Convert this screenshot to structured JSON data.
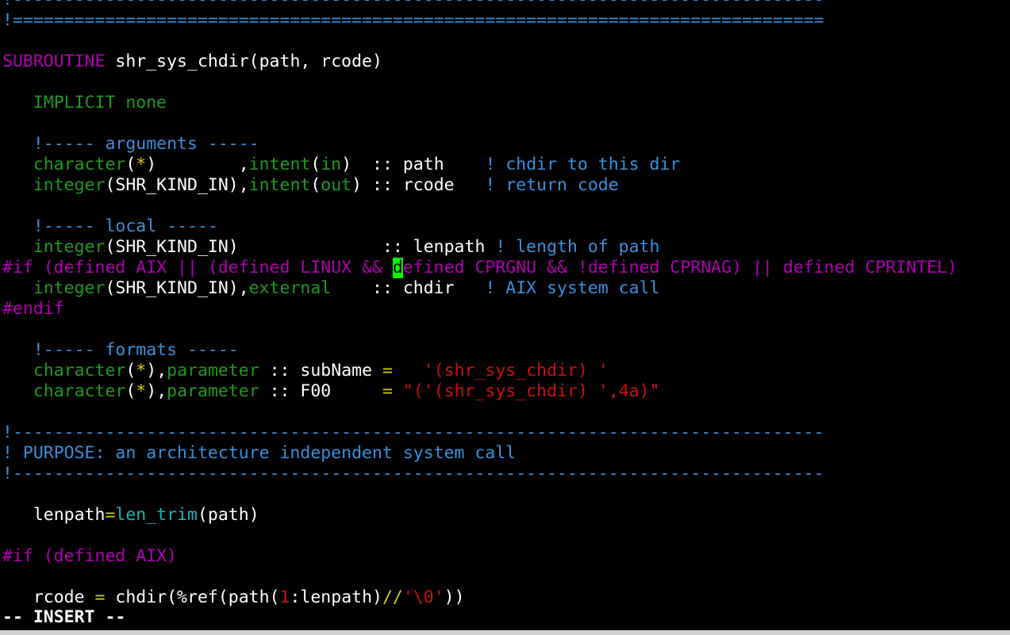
{
  "colors": {
    "background": "#000000",
    "text": "#ffffff",
    "comment": "#3a8fd8",
    "keyword": "#b000b0",
    "type": "#1f9a1f",
    "string": "#cc1010",
    "operator": "#d2d200",
    "func": "#22b0b0",
    "cursor_bg": "#00ff00"
  },
  "editor": {
    "mode": "INSERT",
    "cursor_position": "line 14, col 20",
    "lines": [
      [
        [
          "comment",
          "!-------------------------------------------------------------------------------"
        ]
      ],
      [
        [
          "comment",
          "!==============================================================================="
        ]
      ],
      [],
      [
        [
          "keyword",
          "SUBROUTINE"
        ],
        [
          "text",
          " shr_sys_chdir(path, rcode)"
        ]
      ],
      [],
      [
        [
          "text",
          "   "
        ],
        [
          "type",
          "IMPLICIT none"
        ]
      ],
      [],
      [
        [
          "text",
          "   "
        ],
        [
          "comment",
          "!----- arguments -----"
        ]
      ],
      [
        [
          "text",
          "   "
        ],
        [
          "type",
          "character"
        ],
        [
          "text",
          "("
        ],
        [
          "operator",
          "*"
        ],
        [
          "text",
          ")        ,"
        ],
        [
          "type",
          "intent"
        ],
        [
          "text",
          "("
        ],
        [
          "type",
          "in"
        ],
        [
          "text",
          ")  :: path    "
        ],
        [
          "comment",
          "! chdir to this dir"
        ]
      ],
      [
        [
          "text",
          "   "
        ],
        [
          "type",
          "integer"
        ],
        [
          "text",
          "(SHR_KIND_IN),"
        ],
        [
          "type",
          "intent"
        ],
        [
          "text",
          "("
        ],
        [
          "type",
          "out"
        ],
        [
          "text",
          ") :: rcode   "
        ],
        [
          "comment",
          "! return code"
        ]
      ],
      [],
      [
        [
          "text",
          "   "
        ],
        [
          "comment",
          "!----- local -----"
        ]
      ],
      [
        [
          "text",
          "   "
        ],
        [
          "type",
          "integer"
        ],
        [
          "text",
          "(SHR_KIND_IN)              :: lenpath "
        ],
        [
          "comment",
          "! length of path"
        ]
      ],
      [
        [
          "keyword",
          "#if (defined AIX || (defined LINUX && "
        ],
        [
          "cursor",
          "d"
        ],
        [
          "keyword",
          "efined CPRGNU && !defined CPRNAG) || defined CPRINTEL)"
        ]
      ],
      [
        [
          "text",
          "   "
        ],
        [
          "type",
          "integer"
        ],
        [
          "text",
          "(SHR_KIND_IN),"
        ],
        [
          "type",
          "external"
        ],
        [
          "text",
          "    :: chdir   "
        ],
        [
          "comment",
          "! AIX system call"
        ]
      ],
      [
        [
          "keyword",
          "#endif"
        ]
      ],
      [],
      [
        [
          "text",
          "   "
        ],
        [
          "comment",
          "!----- formats -----"
        ]
      ],
      [
        [
          "text",
          "   "
        ],
        [
          "type",
          "character"
        ],
        [
          "text",
          "("
        ],
        [
          "operator",
          "*"
        ],
        [
          "text",
          "),"
        ],
        [
          "type",
          "parameter"
        ],
        [
          "text",
          " :: subName "
        ],
        [
          "operator",
          "="
        ],
        [
          "text",
          "   "
        ],
        [
          "string",
          "'(shr_sys_chdir) '"
        ]
      ],
      [
        [
          "text",
          "   "
        ],
        [
          "type",
          "character"
        ],
        [
          "text",
          "("
        ],
        [
          "operator",
          "*"
        ],
        [
          "text",
          "),"
        ],
        [
          "type",
          "parameter"
        ],
        [
          "text",
          " :: F00     "
        ],
        [
          "operator",
          "="
        ],
        [
          "text",
          " "
        ],
        [
          "string",
          "\"('(shr_sys_chdir) ',4a)\""
        ]
      ],
      [],
      [
        [
          "comment",
          "!-------------------------------------------------------------------------------"
        ]
      ],
      [
        [
          "comment",
          "! PURPOSE: an architecture independent system call"
        ]
      ],
      [
        [
          "comment",
          "!-------------------------------------------------------------------------------"
        ]
      ],
      [],
      [
        [
          "text",
          "   lenpath"
        ],
        [
          "operator",
          "="
        ],
        [
          "func",
          "len_trim"
        ],
        [
          "text",
          "(path)"
        ]
      ],
      [],
      [
        [
          "keyword",
          "#if (defined AIX)"
        ]
      ],
      [],
      [
        [
          "text",
          "   rcode "
        ],
        [
          "operator",
          "="
        ],
        [
          "text",
          " chdir(%ref(path("
        ],
        [
          "string",
          "1"
        ],
        [
          "text",
          ":lenpath)"
        ],
        [
          "operator",
          "//"
        ],
        [
          "string",
          "'\\0'"
        ],
        [
          "text",
          "))"
        ]
      ]
    ]
  },
  "statusbar": {
    "text": "-- INSERT --"
  }
}
